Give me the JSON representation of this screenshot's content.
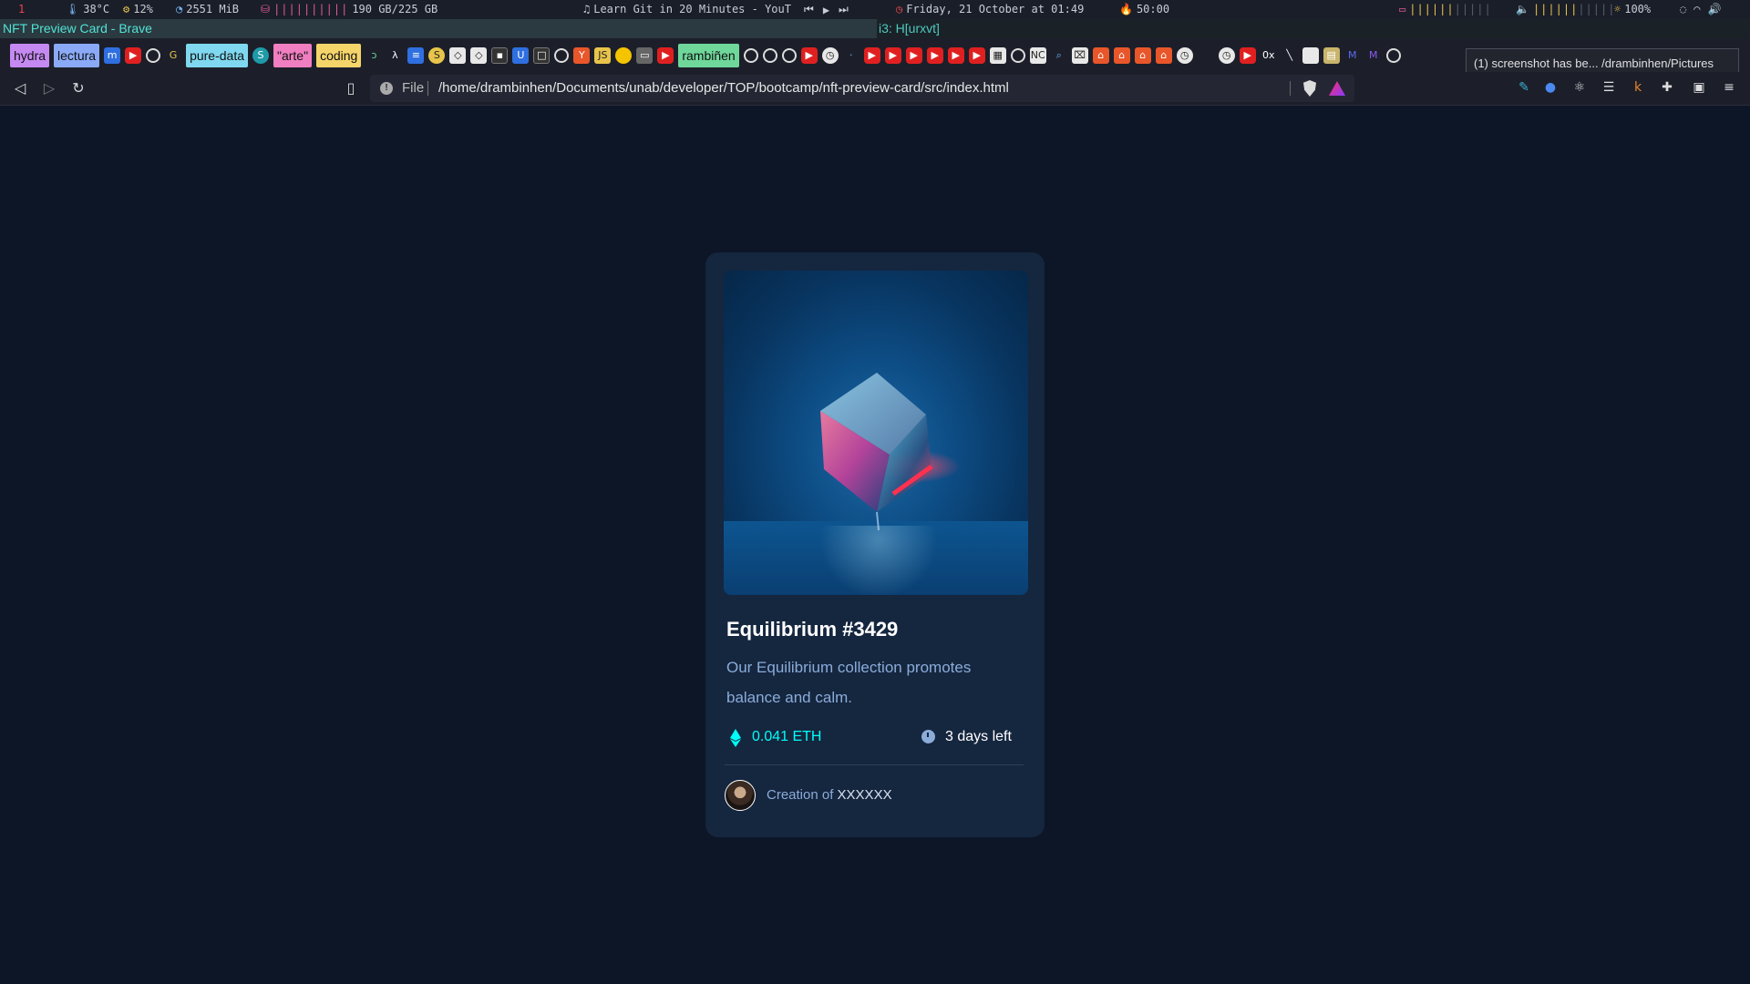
{
  "statusbar": {
    "workspace": "1",
    "temp": "38°C",
    "cpu": "12%",
    "mem": "2551 MiB",
    "disk": "190 GB/225 GB",
    "media_title": "Learn Git in 20 Minutes - YouT",
    "datetime": "Friday, 21 October at 01:49",
    "battery": "50:00",
    "brightness": "100%"
  },
  "window": {
    "title": "NFT Preview Card - Brave",
    "other_title": "i3: H[urxvt]"
  },
  "bookmarks": {
    "hydra": "hydra",
    "lectura": "lectura",
    "pure_data": "pure-data",
    "arte": "\"arte\"",
    "coding": "coding",
    "rambinen": "rambiñen"
  },
  "toast": {
    "text": "(1) screenshot has be... /drambinhen/Pictures"
  },
  "navbar": {
    "scheme_label": "File",
    "url": "/home/drambinhen/Documents/unab/developer/TOP/bootcamp/nft-preview-card/src/index.html"
  },
  "card": {
    "title": "Equilibrium #3429",
    "description": "Our Equilibrium collection promotes balance and calm.",
    "price": "0.041 ETH",
    "time_left": "3 days left",
    "creation_prefix": "Creation of ",
    "creator_name": "XXXXXX"
  },
  "colors": {
    "page_bg": "#0d1627",
    "card_bg": "#15263f",
    "cyan": "#00fff8",
    "soft_blue": "#8bacd9"
  }
}
